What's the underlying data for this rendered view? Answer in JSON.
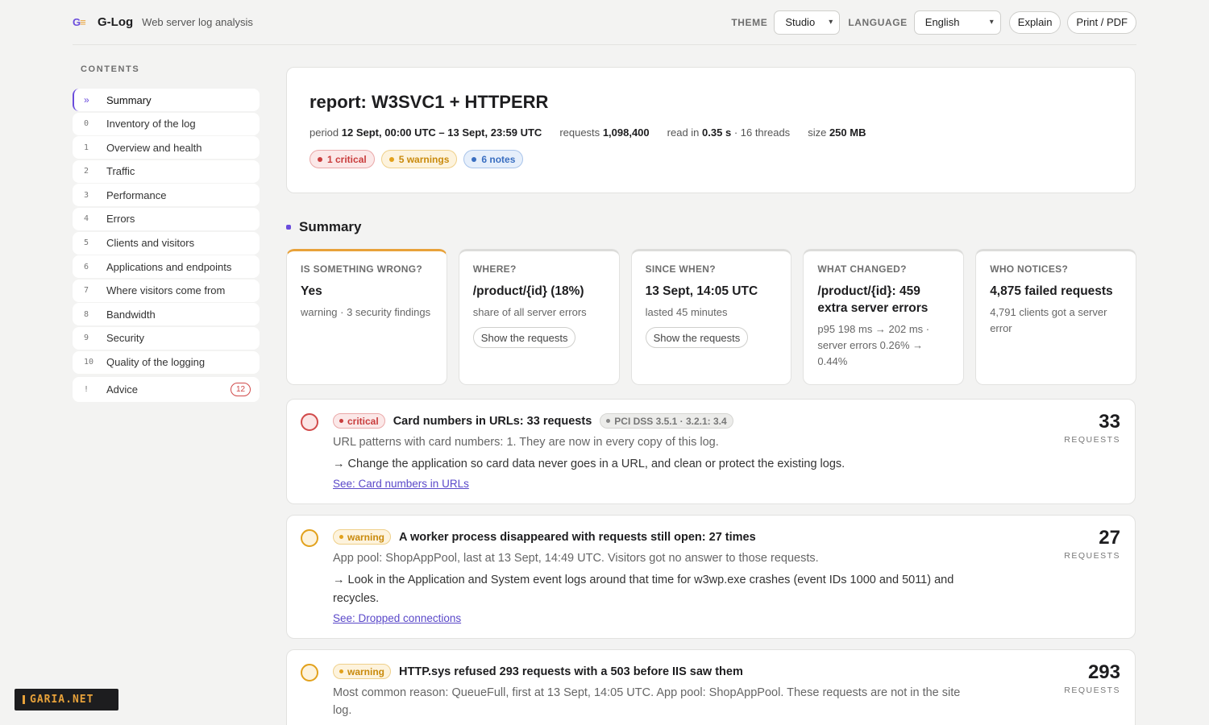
{
  "header": {
    "app_name": "G-Log",
    "subtitle": "Web server log analysis",
    "theme_label": "THEME",
    "theme_value": "Studio",
    "language_label": "LANGUAGE",
    "language_value": "English",
    "explain": "Explain",
    "print": "Print / PDF"
  },
  "sidebar": {
    "heading": "CONTENTS",
    "items": [
      {
        "num": "»",
        "label": "Summary"
      },
      {
        "num": "0",
        "label": "Inventory of the log"
      },
      {
        "num": "1",
        "label": "Overview and health"
      },
      {
        "num": "2",
        "label": "Traffic"
      },
      {
        "num": "3",
        "label": "Performance"
      },
      {
        "num": "4",
        "label": "Errors"
      },
      {
        "num": "5",
        "label": "Clients and visitors"
      },
      {
        "num": "6",
        "label": "Applications and endpoints"
      },
      {
        "num": "7",
        "label": "Where visitors come from"
      },
      {
        "num": "8",
        "label": "Bandwidth"
      },
      {
        "num": "9",
        "label": "Security"
      },
      {
        "num": "10",
        "label": "Quality of the logging"
      },
      {
        "num": "!",
        "label": "Advice",
        "count": "12"
      }
    ]
  },
  "report": {
    "title": "report: W3SVC1 + HTTPERR",
    "period_label": "period",
    "period_value": "12 Sept, 00:00 UTC – 13 Sept, 23:59 UTC",
    "requests_label": "requests",
    "requests_value": "1,098,400",
    "read_label": "read in",
    "read_value": "0.35 s",
    "threads": "· 16 threads",
    "size_label": "size",
    "size_value": "250 MB",
    "critical": "1 critical",
    "warnings": "5 warnings",
    "notes": "6 notes"
  },
  "summary": {
    "heading": "Summary",
    "cards": [
      {
        "q": "IS SOMETHING WRONG?",
        "a": "Yes",
        "d": "warning · 3 security findings"
      },
      {
        "q": "WHERE?",
        "a": "/product/{id} (18%)",
        "d": "share of all server errors",
        "btn": "Show the requests"
      },
      {
        "q": "SINCE WHEN?",
        "a": "13 Sept, 14:05 UTC",
        "d": "lasted 45 minutes",
        "btn": "Show the requests"
      },
      {
        "q": "WHAT CHANGED?",
        "a": "/product/{id}: 459 extra server errors",
        "d": "p95 198 ms → 202 ms · server errors 0.26% → 0.44%"
      },
      {
        "q": "WHO NOTICES?",
        "a": "4,875 failed requests",
        "d": "4,791 clients got a server error"
      }
    ]
  },
  "findings": [
    {
      "severity": "critical",
      "title": "Card numbers in URLs: 33 requests",
      "standard": "PCI DSS 3.5.1 · 3.2.1: 3.4",
      "desc": "URL patterns with card numbers: 1. They are now in every copy of this log.",
      "action": "→ Change the application so card data never goes in a URL, and clean or protect the existing logs.",
      "link": "See: Card numbers in URLs",
      "count": "33",
      "unit": "REQUESTS"
    },
    {
      "severity": "warning",
      "title": "A worker process disappeared with requests still open: 27 times",
      "desc": "App pool: ShopAppPool, last at 13 Sept, 14:49 UTC. Visitors got no answer to those requests.",
      "action": "→ Look in the Application and System event logs around that time for w3wp.exe crashes (event IDs 1000 and 5011) and recycles.",
      "link": "See: Dropped connections",
      "count": "27",
      "unit": "REQUESTS"
    },
    {
      "severity": "warning",
      "title": "HTTP.sys refused 293 requests with a 503 before IIS saw them",
      "desc": "Most common reason: QueueFull, first at 13 Sept, 14:05 UTC. App pool: ShopAppPool. These requests are not in the site log.",
      "count": "293",
      "unit": "REQUESTS"
    }
  ],
  "watermark": "GARIA.NET"
}
